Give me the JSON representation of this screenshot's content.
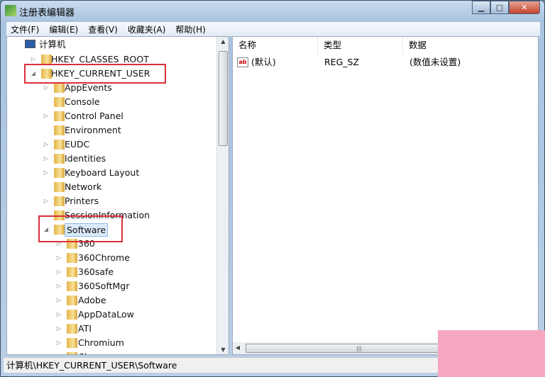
{
  "window": {
    "title": "注册表编辑器",
    "controls": [
      "minimize",
      "maximize",
      "close"
    ]
  },
  "menu": [
    "文件(F)",
    "编辑(E)",
    "查看(V)",
    "收藏夹(A)",
    "帮助(H)"
  ],
  "tree": [
    {
      "label": "计算机",
      "level": 0,
      "expanded": true,
      "icon": "computer-icon"
    },
    {
      "label": "HKEY_CLASSES_ROOT",
      "level": 1,
      "expanded": false
    },
    {
      "label": "HKEY_CURRENT_USER",
      "level": 1,
      "expanded": true,
      "highlighted": true
    },
    {
      "label": "AppEvents",
      "level": 2,
      "expanded": false
    },
    {
      "label": "Console",
      "level": 2
    },
    {
      "label": "Control Panel",
      "level": 2,
      "expanded": false
    },
    {
      "label": "Environment",
      "level": 2
    },
    {
      "label": "EUDC",
      "level": 2,
      "expanded": false
    },
    {
      "label": "Identities",
      "level": 2,
      "expanded": false
    },
    {
      "label": "Keyboard Layout",
      "level": 2,
      "expanded": false
    },
    {
      "label": "Network",
      "level": 2
    },
    {
      "label": "Printers",
      "level": 2,
      "expanded": false
    },
    {
      "label": "SessionInformation",
      "level": 2
    },
    {
      "label": "Software",
      "level": 2,
      "expanded": true,
      "selected": true,
      "highlighted": true
    },
    {
      "label": "360",
      "level": 3,
      "expanded": false
    },
    {
      "label": "360Chrome",
      "level": 3,
      "expanded": false
    },
    {
      "label": "360safe",
      "level": 3,
      "expanded": false
    },
    {
      "label": "360SoftMgr",
      "level": 3,
      "expanded": false
    },
    {
      "label": "Adobe",
      "level": 3,
      "expanded": false
    },
    {
      "label": "AppDataLow",
      "level": 3,
      "expanded": false
    },
    {
      "label": "ATI",
      "level": 3,
      "expanded": false
    },
    {
      "label": "Chromium",
      "level": 3,
      "expanded": false
    },
    {
      "label": "Cl...",
      "level": 3,
      "expanded": false
    }
  ],
  "list": {
    "columns": [
      "名称",
      "类型",
      "数据"
    ],
    "rows": [
      {
        "name": "(默认)",
        "type": "REG_SZ",
        "data": "(数值未设置)",
        "icon": "ab"
      }
    ]
  },
  "status": "计算机\\HKEY_CURRENT_USER\\Software",
  "colors": {
    "highlight_box": "#d9303a",
    "overlay": "#f7a6c2"
  }
}
